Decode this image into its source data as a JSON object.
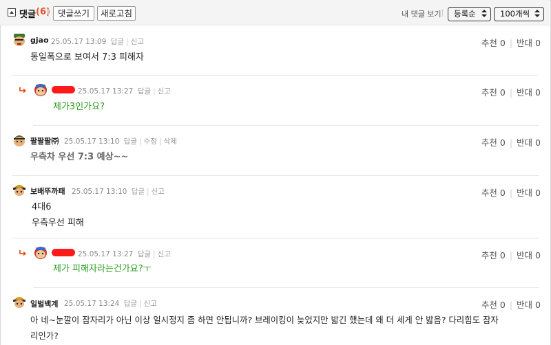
{
  "header": {
    "title": "댓글",
    "count": "(6)",
    "write_button": "댓글쓰기",
    "refresh_button": "새로고침",
    "my_comments_link": "내 댓글 보기",
    "sort_select": "등록순",
    "per_page_select": "100개씩"
  },
  "comments": [
    {
      "nick": "gjao",
      "date": "25.05.17 13:09",
      "actions": [
        "답글",
        "신고"
      ],
      "body": [
        "동일폭으로 보여서 7:3 피해자"
      ],
      "up_label": "추천",
      "up": "0",
      "down_label": "반대",
      "down": "0"
    },
    {
      "nick": "",
      "date": "25.05.17 13:27",
      "actions": [
        "답글",
        "신고"
      ],
      "body": [
        "제가3인가요?"
      ],
      "up_label": "추천",
      "up": "0",
      "down_label": "반대",
      "down": "0"
    },
    {
      "nick": "팔팔팔㈜",
      "date": "25.05.17 13:10",
      "actions": [
        "답글",
        "수정",
        "삭제"
      ],
      "body": [
        "우측차 우선 7:3 예상~~"
      ],
      "up_label": "추천",
      "up": "0",
      "down_label": "반대",
      "down": "0"
    },
    {
      "nick": "보배뚜까패",
      "date": "25.05.17 13:10",
      "actions": [
        "답글",
        "신고"
      ],
      "body": [
        "4대6",
        "우측우선 피해"
      ],
      "up_label": "추천",
      "up": "0",
      "down_label": "반대",
      "down": "0"
    },
    {
      "nick": "",
      "date": "25.05.17 13:27",
      "actions": [
        "답글",
        "신고"
      ],
      "body": [
        "제가 피해자라는건가요?ㅜ"
      ],
      "up_label": "추천",
      "up": "0",
      "down_label": "반대",
      "down": "0"
    },
    {
      "nick": "일벌백계",
      "date": "25.05.17 13:24",
      "actions": [
        "답글",
        "신고"
      ],
      "body": [
        "아 네~눈깔이 잠자리가 아닌 이상 일시정지 좀 하면 안됩니까? 브레이킹이 늦었지만 밟긴 했는데 왜 더 세게 안 밟음? 다리힘도 잠자",
        "리인가?"
      ],
      "up_label": "추천",
      "up": "0",
      "down_label": "반대",
      "down": "0"
    }
  ],
  "colors": {
    "count": "#e0552b",
    "reply_text": "#2a9d1e",
    "reply_arrow": "#e5541c",
    "redaction": "#ff1a1a"
  }
}
